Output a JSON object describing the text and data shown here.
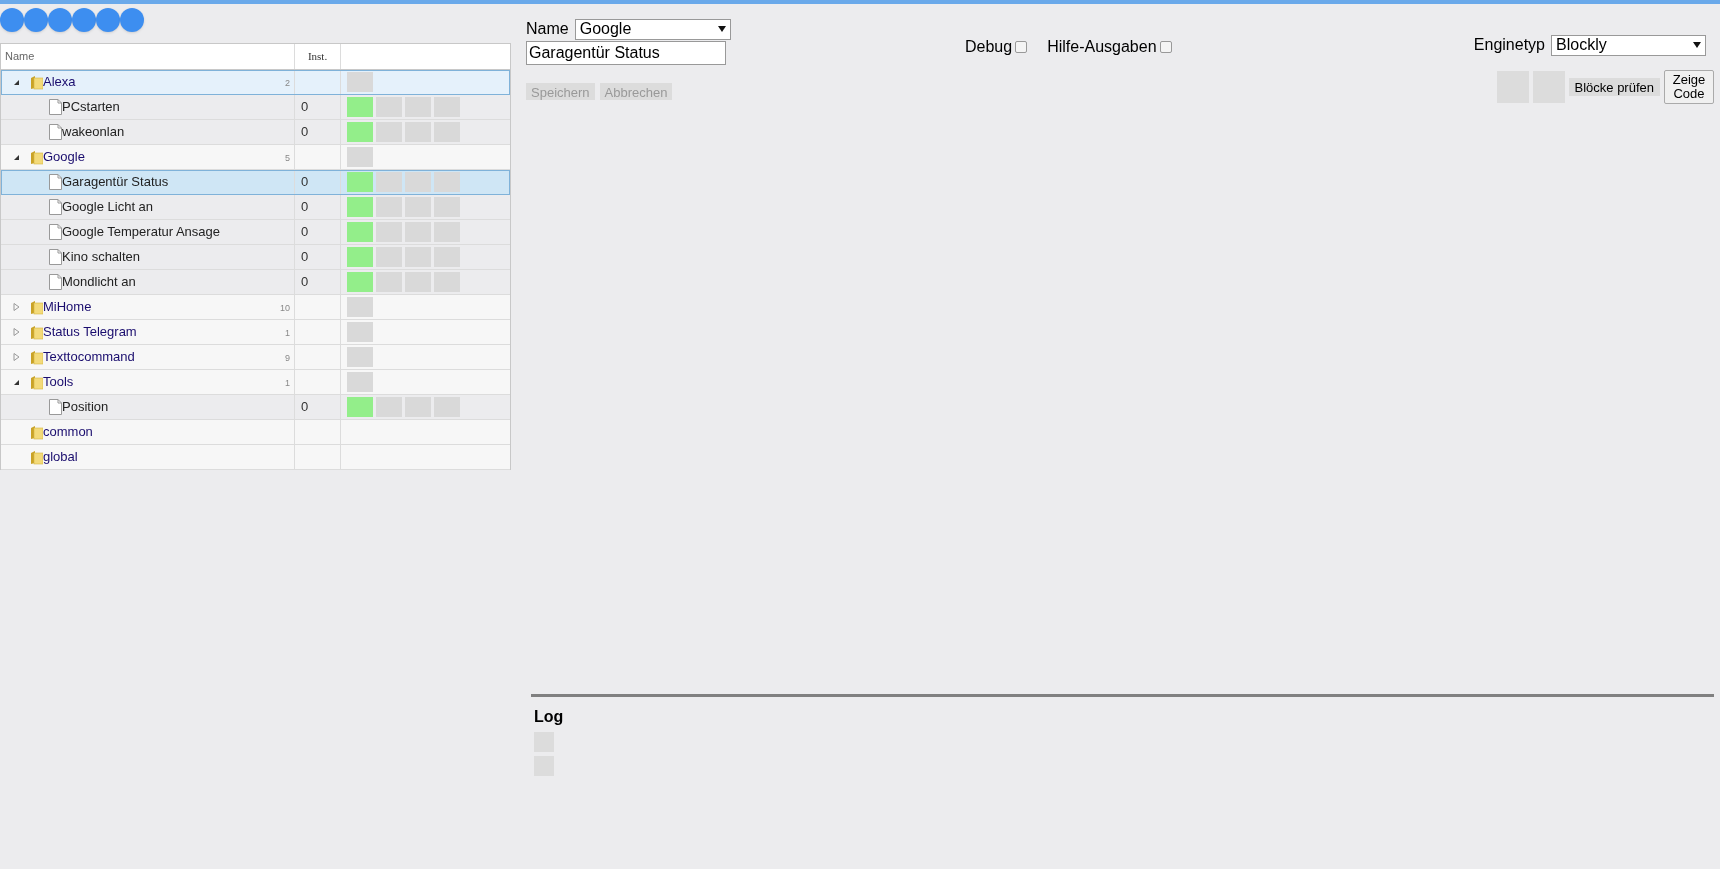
{
  "tree": {
    "columns": [
      "Name",
      "Inst."
    ],
    "items": [
      {
        "kind": "folder",
        "name": "Alexa",
        "count": "2",
        "expanded": true,
        "has_button": true,
        "selected": false,
        "hovered": true,
        "children": [
          {
            "kind": "script",
            "name": "PCstarten",
            "inst": "0",
            "enabled": true,
            "selected": false
          },
          {
            "kind": "script",
            "name": "wakeonlan",
            "inst": "0",
            "enabled": true,
            "selected": false
          }
        ]
      },
      {
        "kind": "folder",
        "name": "Google",
        "count": "5",
        "expanded": true,
        "has_button": true,
        "selected": false,
        "hovered": false,
        "children": [
          {
            "kind": "script",
            "name": "Garagentür Status",
            "inst": "0",
            "enabled": true,
            "selected": true
          },
          {
            "kind": "script",
            "name": "Google Licht an",
            "inst": "0",
            "enabled": true,
            "selected": false
          },
          {
            "kind": "script",
            "name": "Google Temperatur Ansage",
            "inst": "0",
            "enabled": true,
            "selected": false
          },
          {
            "kind": "script",
            "name": "Kino schalten",
            "inst": "0",
            "enabled": true,
            "selected": false
          },
          {
            "kind": "script",
            "name": "Mondlicht an",
            "inst": "0",
            "enabled": true,
            "selected": false
          }
        ]
      },
      {
        "kind": "folder",
        "name": "MiHome",
        "count": "10",
        "expanded": false,
        "has_button": true,
        "selected": false,
        "hovered": false
      },
      {
        "kind": "folder",
        "name": "Status Telegram",
        "count": "1",
        "expanded": false,
        "has_button": true,
        "selected": false,
        "hovered": false
      },
      {
        "kind": "folder",
        "name": "Texttocommand",
        "count": "9",
        "expanded": false,
        "has_button": true,
        "selected": false,
        "hovered": false
      },
      {
        "kind": "folder",
        "name": "Tools",
        "count": "1",
        "expanded": true,
        "has_button": true,
        "selected": false,
        "hovered": false,
        "children": [
          {
            "kind": "script",
            "name": "Position",
            "inst": "0",
            "enabled": true,
            "selected": false
          }
        ]
      },
      {
        "kind": "folder",
        "name": "common",
        "has_button": false,
        "selected": false,
        "hovered": false
      },
      {
        "kind": "folder",
        "name": "global",
        "has_button": false,
        "selected": false,
        "hovered": false
      }
    ]
  },
  "editor": {
    "name_label": "Name",
    "group": "Google",
    "script_name": "Garagentür Status",
    "debug": {
      "label": "Debug",
      "checked": false
    },
    "verbose": {
      "label": "Hilfe-Ausgaben",
      "checked": false
    },
    "engine_label": "Enginetyp",
    "engine": "Blockly",
    "save": {
      "label": "Speichern",
      "disabled": true
    },
    "cancel": {
      "label": "Abbrechen",
      "disabled": true
    },
    "check_blocks": "Blöcke prüfen",
    "show_code": "Zeige Code"
  },
  "log": {
    "title": "Log"
  }
}
